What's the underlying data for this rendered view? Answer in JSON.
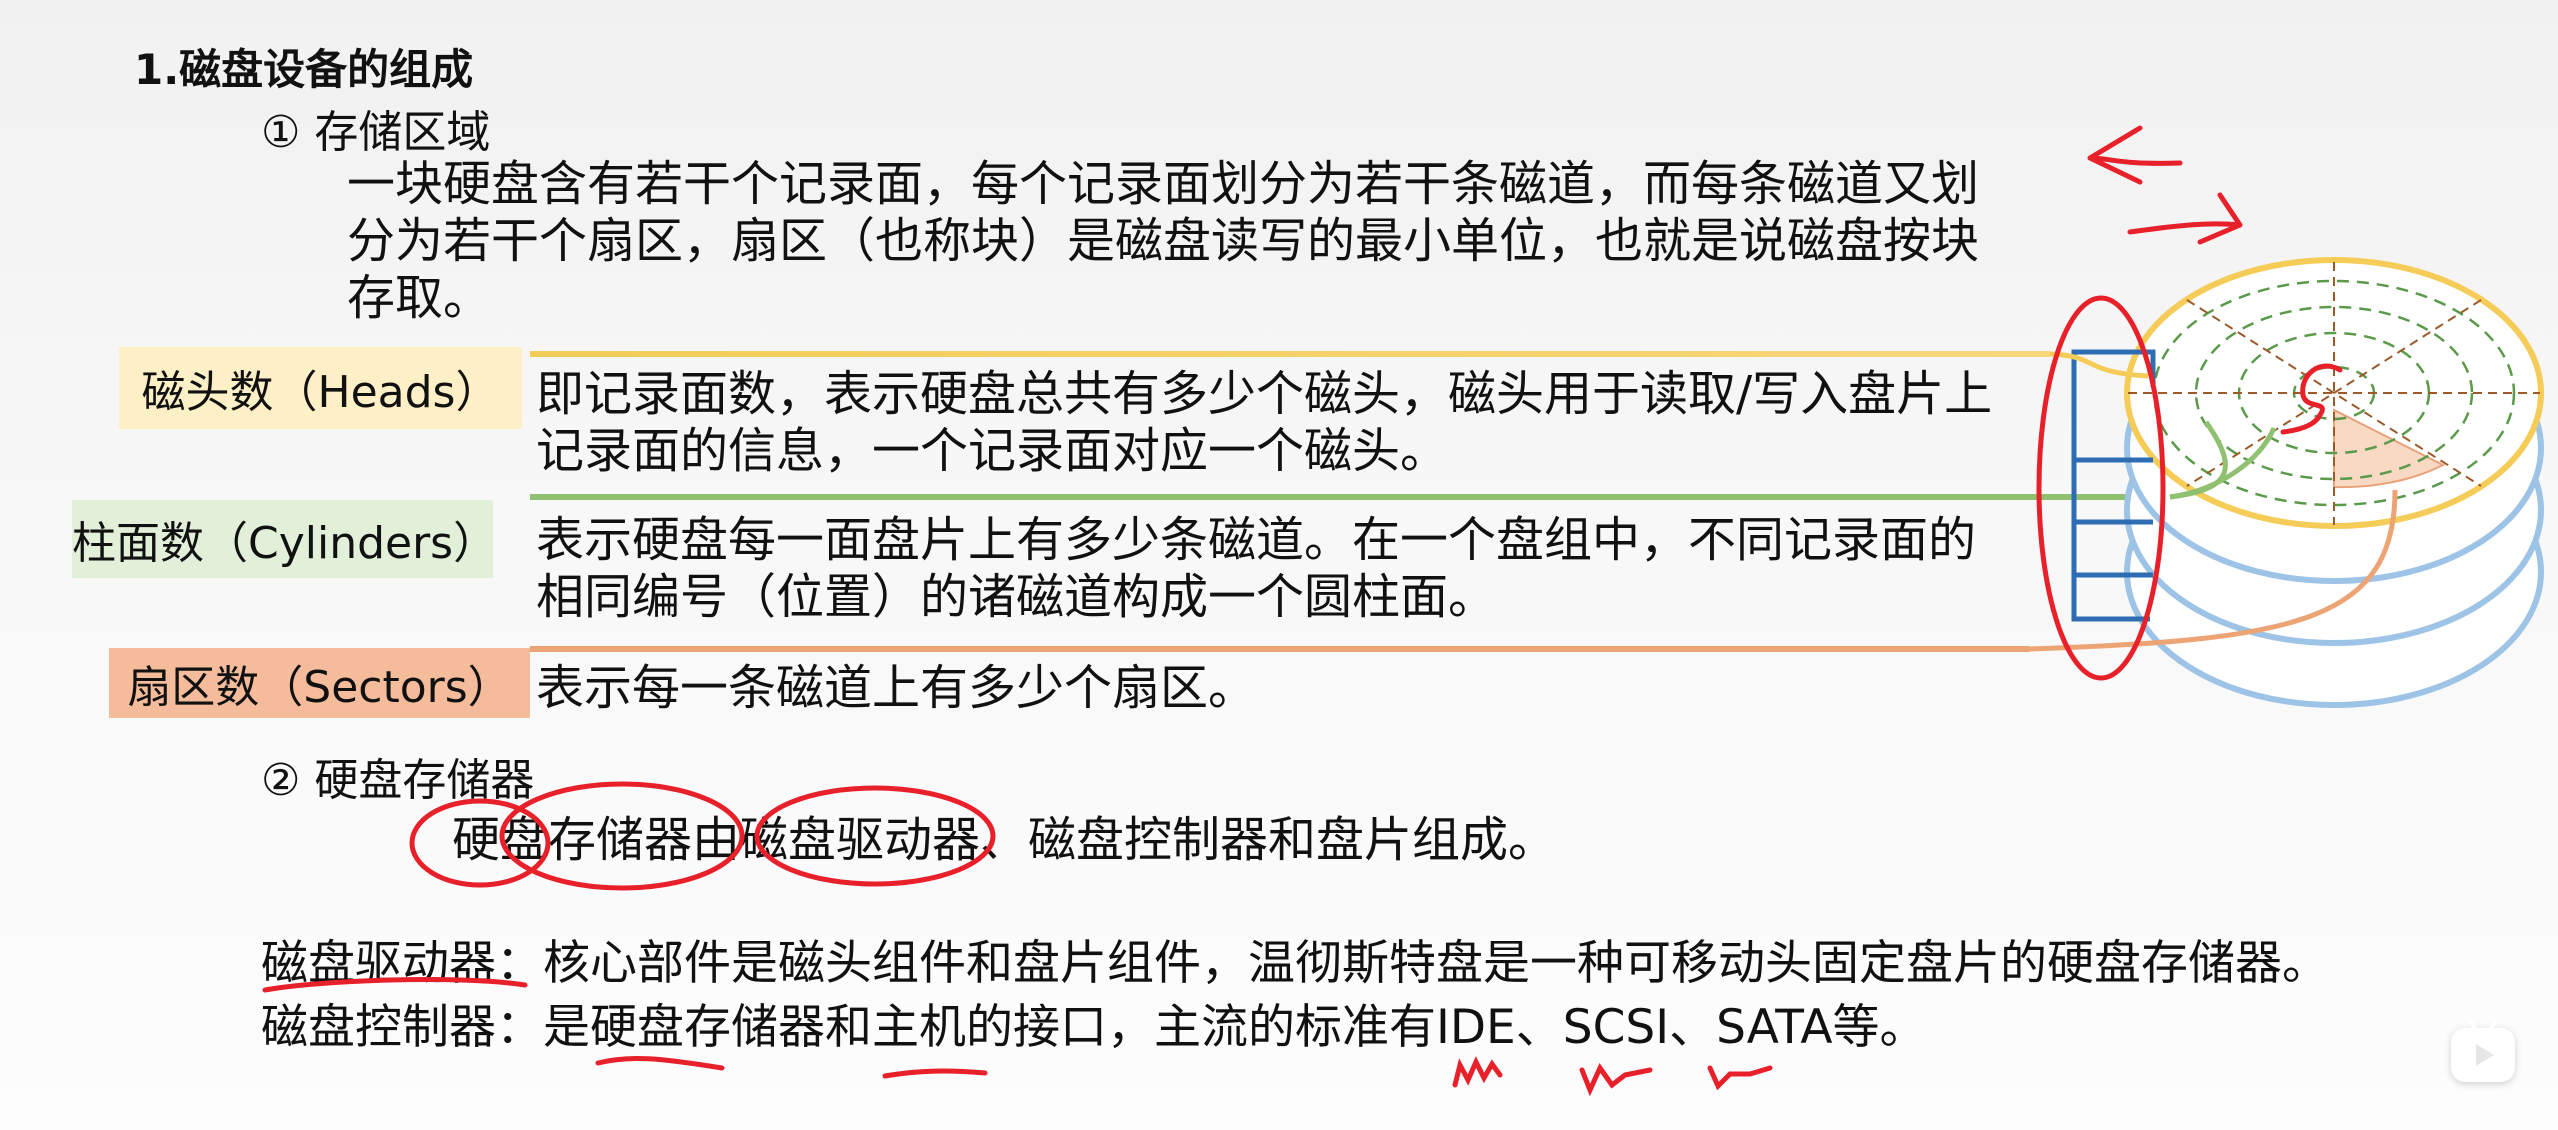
{
  "title": "1.磁盘设备的组成",
  "section1": {
    "heading": "① 存储区域",
    "lines": [
      "一块硬盘含有若干个记录面，每个记录面划分为若干条磁道，而每条磁道又划",
      "分为若干个扇区，扇区（也称块）是磁盘读写的最小单位，也就是说磁盘按块",
      "存取。"
    ]
  },
  "params": [
    {
      "label": "磁头数（Heads）",
      "color": "#fdefc6",
      "line_color": "#f5cc57",
      "lines": [
        "即记录面数，表示硬盘总共有多少个磁头，磁头用于读取/写入盘片上",
        "记录面的信息，一个记录面对应一个磁头。"
      ]
    },
    {
      "label": "柱面数（Cylinders）",
      "color": "#e2efd9",
      "line_color": "#8fc170",
      "lines": [
        "表示硬盘每一面盘片上有多少条磁道。在一个盘组中，不同记录面的",
        "相同编号（位置）的诸磁道构成一个圆柱面。"
      ]
    },
    {
      "label": "扇区数（Sectors）",
      "color": "#f5bc9c",
      "line_color": "#eda474",
      "lines": [
        "表示每一条磁道上有多少个扇区。"
      ]
    }
  ],
  "section2": {
    "heading": "② 硬盘存储器",
    "intro": "硬盘存储器由磁盘驱动器、磁盘控制器和盘片组成。",
    "drive": "磁盘驱动器：核心部件是磁头组件和盘片组件，温彻斯特盘是一种可移动头固定盘片的硬盘存储器。",
    "controller": "磁盘控制器：是硬盘存储器和主机的接口，主流的标准有IDE、SCSI、SATA等。"
  },
  "colors": {
    "annotation": "#e8202a",
    "platter_top": "#f5cc57",
    "platter": "#9dc3e6",
    "head_arm": "#2e6db4",
    "track": "#5a9a4a",
    "sector": "#f8d9c4"
  },
  "icons": [
    "tv-play-icon"
  ]
}
